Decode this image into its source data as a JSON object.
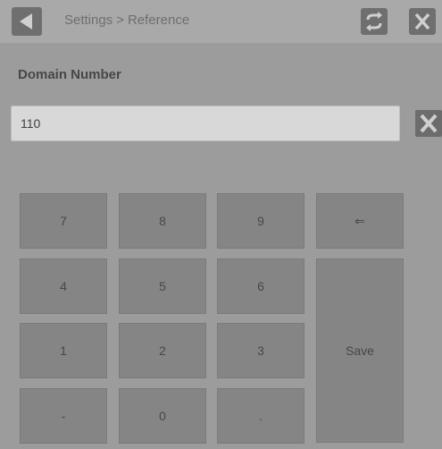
{
  "header": {
    "breadcrumb_parent": "Settings",
    "breadcrumb_separator": ">",
    "breadcrumb_current": "Reference"
  },
  "field": {
    "label": "Domain Number",
    "value": "110"
  },
  "keypad": {
    "k7": "7",
    "k8": "8",
    "k9": "9",
    "backspace": "⇐",
    "k4": "4",
    "k5": "5",
    "k6": "6",
    "k1": "1",
    "k2": "2",
    "k3": "3",
    "minus": "-",
    "k0": "0",
    "dot": ".",
    "save": "Save"
  },
  "icons": {
    "back": "back-arrow-icon",
    "refresh": "refresh-icon",
    "close": "close-icon",
    "clear": "clear-icon"
  },
  "colors": {
    "background": "#9c9c9c",
    "key": "#858585",
    "icon_button": "#6f6f6f"
  }
}
